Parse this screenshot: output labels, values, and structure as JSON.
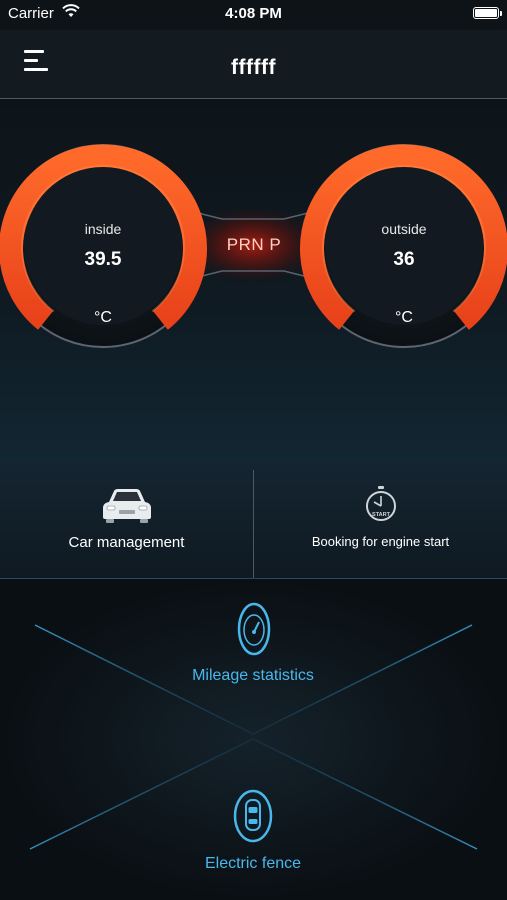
{
  "status_bar": {
    "carrier": "Carrier",
    "time": "4:08 PM"
  },
  "nav": {
    "title": "ffffff",
    "menu_icon": "hamburger-menu-icon"
  },
  "gauges": {
    "gear": "PRN P",
    "inside": {
      "label": "inside",
      "value": "39.5",
      "unit": "°C"
    },
    "outside": {
      "label": "outside",
      "value": "36",
      "unit": "°C"
    },
    "accent_color": "#ff5a1f"
  },
  "actions": {
    "car_management": {
      "label": "Car management",
      "icon": "car-icon"
    },
    "booking_engine_start": {
      "label": "Booking for engine start",
      "icon": "clock-start-icon"
    },
    "mileage_statistics": {
      "label": "Mileage statistics",
      "icon": "speedometer-icon"
    },
    "electric_fence": {
      "label": "Electric fence",
      "icon": "car-topview-icon"
    },
    "accent_color": "#48b8ec"
  }
}
